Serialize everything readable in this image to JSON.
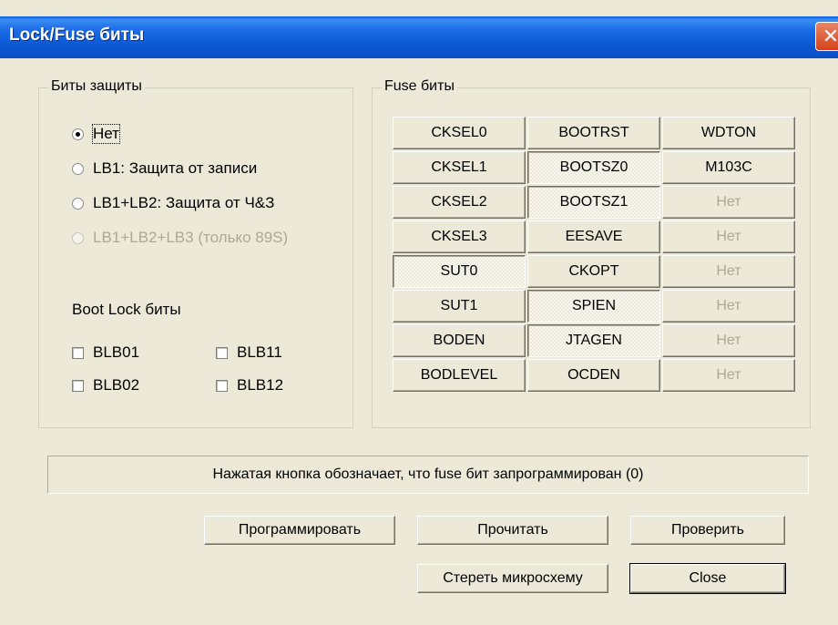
{
  "window": {
    "title": "Lock/Fuse биты",
    "close_glyph": "✕"
  },
  "lock_group": {
    "legend": "Биты защиты",
    "options": [
      {
        "label": "Нет",
        "checked": true,
        "enabled": true
      },
      {
        "label": "LB1: Защита от записи",
        "checked": false,
        "enabled": true
      },
      {
        "label": "LB1+LB2: Защита от Ч&З",
        "checked": false,
        "enabled": true
      },
      {
        "label": "LB1+LB2+LB3 (только 89S)",
        "checked": false,
        "enabled": false
      }
    ],
    "boot_lock_label": "Boot Lock биты",
    "boot_lock": [
      {
        "label": "BLB01",
        "checked": false
      },
      {
        "label": "BLB11",
        "checked": false
      },
      {
        "label": "BLB02",
        "checked": false
      },
      {
        "label": "BLB12",
        "checked": false
      }
    ]
  },
  "fuse_group": {
    "legend": "Fuse биты",
    "columns": [
      [
        {
          "label": "CKSEL0",
          "pressed": false,
          "enabled": true
        },
        {
          "label": "CKSEL1",
          "pressed": false,
          "enabled": true
        },
        {
          "label": "CKSEL2",
          "pressed": false,
          "enabled": true
        },
        {
          "label": "CKSEL3",
          "pressed": false,
          "enabled": true
        },
        {
          "label": "SUT0",
          "pressed": true,
          "enabled": true
        },
        {
          "label": "SUT1",
          "pressed": false,
          "enabled": true
        },
        {
          "label": "BODEN",
          "pressed": false,
          "enabled": true
        },
        {
          "label": "BODLEVEL",
          "pressed": false,
          "enabled": true
        }
      ],
      [
        {
          "label": "BOOTRST",
          "pressed": false,
          "enabled": true
        },
        {
          "label": "BOOTSZ0",
          "pressed": true,
          "enabled": true
        },
        {
          "label": "BOOTSZ1",
          "pressed": true,
          "enabled": true
        },
        {
          "label": "EESAVE",
          "pressed": false,
          "enabled": true
        },
        {
          "label": "CKOPT",
          "pressed": false,
          "enabled": true
        },
        {
          "label": "SPIEN",
          "pressed": true,
          "enabled": true
        },
        {
          "label": "JTAGEN",
          "pressed": true,
          "enabled": true
        },
        {
          "label": "OCDEN",
          "pressed": false,
          "enabled": true
        }
      ],
      [
        {
          "label": "WDTON",
          "pressed": false,
          "enabled": true
        },
        {
          "label": "M103C",
          "pressed": false,
          "enabled": true
        },
        {
          "label": "Нет",
          "pressed": false,
          "enabled": false
        },
        {
          "label": "Нет",
          "pressed": false,
          "enabled": false
        },
        {
          "label": "Нет",
          "pressed": false,
          "enabled": false
        },
        {
          "label": "Нет",
          "pressed": false,
          "enabled": false
        },
        {
          "label": "Нет",
          "pressed": false,
          "enabled": false
        },
        {
          "label": "Нет",
          "pressed": false,
          "enabled": false
        }
      ]
    ]
  },
  "info_text": "Нажатая кнопка обозначает, что fuse бит запрограммирован (0)",
  "buttons": {
    "program": "Программировать",
    "read": "Прочитать",
    "verify": "Проверить",
    "erase": "Стереть микросхему",
    "close": "Close"
  },
  "colors": {
    "titlebar": "#0a5fd8",
    "face": "#ece9d8",
    "disabled_text": "#aca899"
  }
}
